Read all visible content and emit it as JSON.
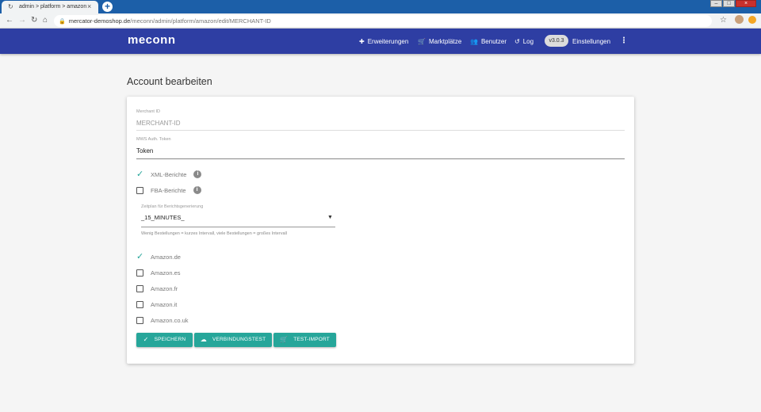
{
  "browser": {
    "tab_title": "admin > platform > amazon",
    "tab_close": "×",
    "new_tab": "+",
    "url_host": "mercator-demoshop.de",
    "url_path": "/meconn/admin/platform/amazon/edit/MERCHANT-ID"
  },
  "app": {
    "logo": "meconn",
    "nav": {
      "extensions": "Erweiterungen",
      "marketplaces": "Marktplätze",
      "users": "Benutzer",
      "log": "Log",
      "version": "v3.0.3",
      "settings": "Einstellungen"
    }
  },
  "page": {
    "title": "Account bearbeiten"
  },
  "form": {
    "merchant_id": {
      "label": "Merchant ID",
      "value": "MERCHANT-ID"
    },
    "mws_token": {
      "label": "MWS Auth. Token",
      "value": "Token"
    },
    "options": [
      {
        "label": "XML-Berichte",
        "checked": true,
        "info": true
      },
      {
        "label": "FBA-Berichte",
        "checked": false,
        "info": true
      }
    ],
    "schedule": {
      "label": "Zeitplan für Berichtsgenerierung",
      "value": "_15_MINUTES_",
      "hint": "Wenig Bestellungen = kurzes Intervall, viele Bestellungen = großes Intervall"
    },
    "marketplaces": [
      {
        "label": "Amazon.de",
        "checked": true
      },
      {
        "label": "Amazon.es",
        "checked": false
      },
      {
        "label": "Amazon.fr",
        "checked": false
      },
      {
        "label": "Amazon.it",
        "checked": false
      },
      {
        "label": "Amazon.co.uk",
        "checked": false
      }
    ],
    "buttons": {
      "save": "SPEICHERN",
      "connection_test": "VERBINDUNGSTEST",
      "test_import": "TEST-IMPORT"
    }
  },
  "colors": {
    "header": "#2e3ea3",
    "accent": "#26a69a",
    "browser": "#1c5fa8"
  }
}
